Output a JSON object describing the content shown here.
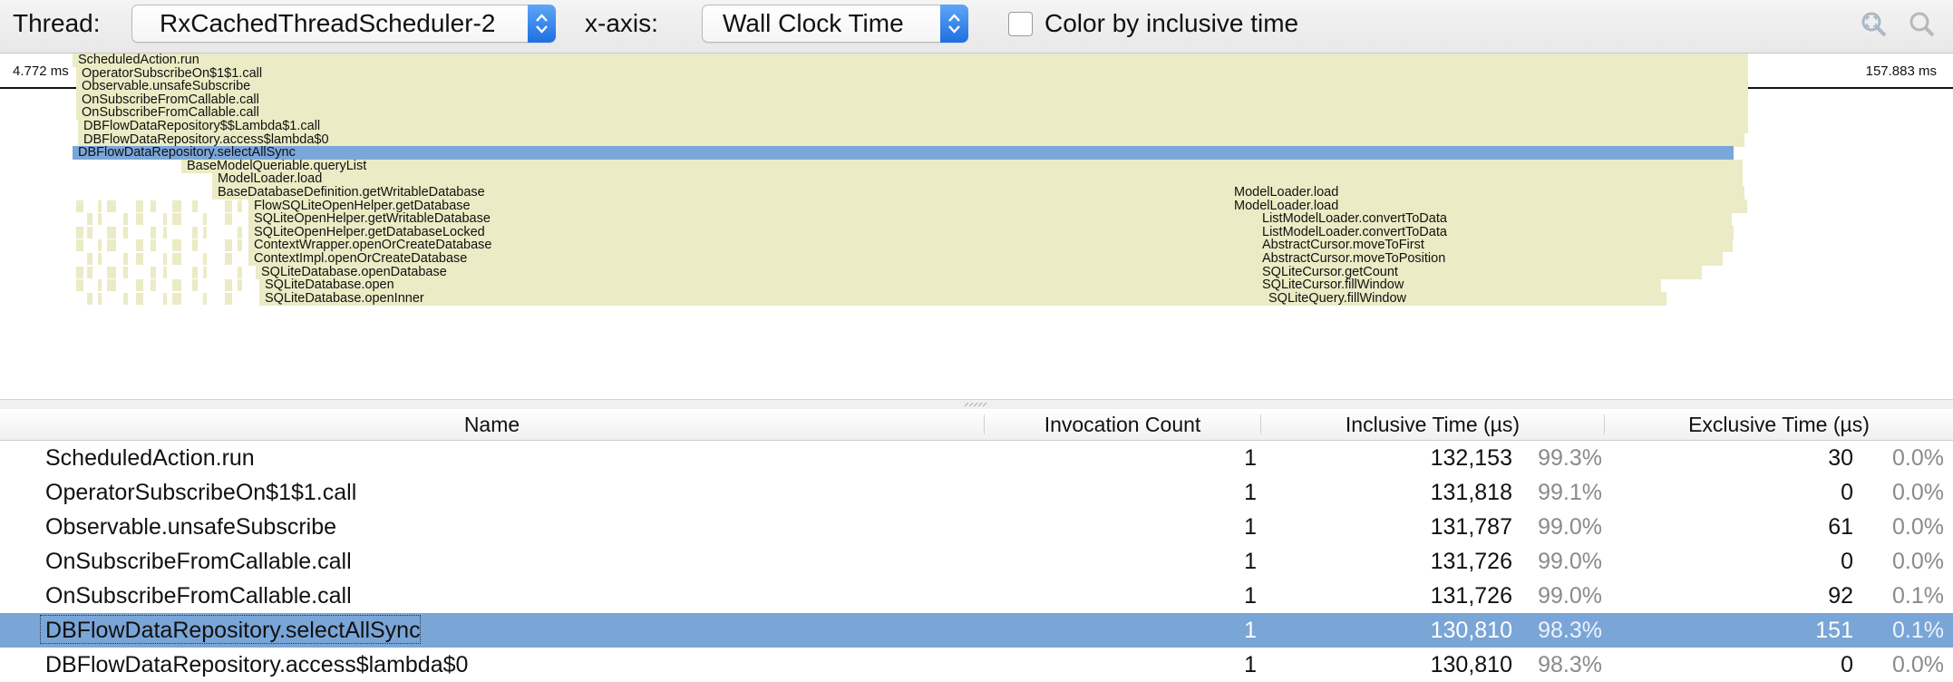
{
  "toolbar": {
    "thread_label": "Thread:",
    "thread_value": "RxCachedThreadScheduler-2",
    "xaxis_label": "x-axis:",
    "xaxis_value": "Wall Clock Time",
    "color_by_label": "Color by inclusive time",
    "color_by_checked": false
  },
  "flame": {
    "start_time": "4.772 ms",
    "end_time": "157.883 ms",
    "frames": [
      "ScheduledAction.run",
      "OperatorSubscribeOn$1$1.call",
      "Observable.unsafeSubscribe",
      "OnSubscribeFromCallable.call",
      "OnSubscribeFromCallable.call",
      "DBFlowDataRepository$$Lambda$1.call",
      "DBFlowDataRepository.access$lambda$0",
      "DBFlowDataRepository.selectAllSync",
      "BaseModelQueriable.queryList",
      "ModelLoader.load",
      "BaseDatabaseDefinition.getWritableDatabase",
      "FlowSQLiteOpenHelper.getDatabase",
      "SQLiteOpenHelper.getWritableDatabase",
      "SQLiteOpenHelper.getDatabaseLocked",
      "ContextWrapper.openOrCreateDatabase",
      "ContextImpl.openOrCreateDatabase",
      "SQLiteDatabase.openDatabase",
      "SQLiteDatabase.open",
      "SQLiteDatabase.openInner"
    ],
    "right_frames": [
      "ModelLoader.load",
      "ModelLoader.load",
      "ListModelLoader.convertToData",
      "ListModelLoader.convertToData",
      "AbstractCursor.moveToFirst",
      "AbstractCursor.moveToPosition",
      "SQLiteCursor.getCount",
      "SQLiteCursor.fillWindow",
      "SQLiteQuery.fillWindow"
    ],
    "bar_color": "#ebebc5",
    "selected_color": "#7aa6d9"
  },
  "table": {
    "headers": {
      "name": "Name",
      "invocation_count": "Invocation Count",
      "inclusive_time": "Inclusive Time (µs)",
      "exclusive_time": "Exclusive Time (µs)"
    },
    "rows": [
      {
        "name": "ScheduledAction.run",
        "count": "1",
        "inclusive": "132,153",
        "inclusive_pct": "99.3%",
        "exclusive": "30",
        "exclusive_pct": "0.0%"
      },
      {
        "name": "OperatorSubscribeOn$1$1.call",
        "count": "1",
        "inclusive": "131,818",
        "inclusive_pct": "99.1%",
        "exclusive": "0",
        "exclusive_pct": "0.0%"
      },
      {
        "name": "Observable.unsafeSubscribe",
        "count": "1",
        "inclusive": "131,787",
        "inclusive_pct": "99.0%",
        "exclusive": "61",
        "exclusive_pct": "0.0%"
      },
      {
        "name": "OnSubscribeFromCallable.call",
        "count": "1",
        "inclusive": "131,726",
        "inclusive_pct": "99.0%",
        "exclusive": "0",
        "exclusive_pct": "0.0%"
      },
      {
        "name": "OnSubscribeFromCallable.call",
        "count": "1",
        "inclusive": "131,726",
        "inclusive_pct": "99.0%",
        "exclusive": "92",
        "exclusive_pct": "0.1%"
      },
      {
        "name": "DBFlowDataRepository.selectAllSync",
        "count": "1",
        "inclusive": "130,810",
        "inclusive_pct": "98.3%",
        "exclusive": "151",
        "exclusive_pct": "0.1%",
        "selected": true
      },
      {
        "name": "DBFlowDataRepository.access$lambda$0",
        "count": "1",
        "inclusive": "130,810",
        "inclusive_pct": "98.3%",
        "exclusive": "0",
        "exclusive_pct": "0.0%"
      }
    ],
    "selected_color": "#7aa5d7"
  }
}
